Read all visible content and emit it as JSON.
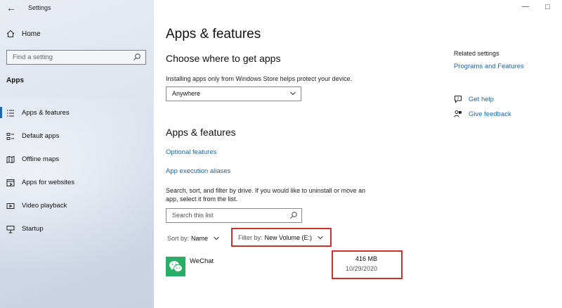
{
  "window": {
    "title": "Settings"
  },
  "sidebar": {
    "home_label": "Home",
    "search_placeholder": "Find a setting",
    "section_label": "Apps",
    "items": [
      {
        "label": "Apps & features",
        "icon": "list-icon",
        "active": true
      },
      {
        "label": "Default apps",
        "icon": "default-apps-icon",
        "active": false
      },
      {
        "label": "Offline maps",
        "icon": "map-icon",
        "active": false
      },
      {
        "label": "Apps for websites",
        "icon": "web-app-icon",
        "active": false
      },
      {
        "label": "Video playback",
        "icon": "video-icon",
        "active": false
      },
      {
        "label": "Startup",
        "icon": "startup-icon",
        "active": false
      }
    ]
  },
  "main": {
    "title": "Apps & features",
    "choose_heading": "Choose where to get apps",
    "choose_text": "Installing apps only from Windows Store helps protect your device.",
    "source_dropdown": "Anywhere",
    "apps_heading": "Apps & features",
    "optional_features_link": "Optional features",
    "aliases_link": "App execution aliases",
    "search_help_line1": "Search, sort, and filter by drive. If you would like to uninstall or move an",
    "search_help_line2": "app, select it from the list.",
    "search_placeholder": "Search this list",
    "sort_label": "Sort by:",
    "sort_value": "Name",
    "filter_label": "Filter by:",
    "filter_value": "New Volume (E:)",
    "apps": [
      {
        "name": "WeChat",
        "size": "416 MB",
        "date": "10/29/2020",
        "icon": "wechat-icon"
      }
    ]
  },
  "related": {
    "heading": "Related settings",
    "programs_link": "Programs and Features",
    "get_help": "Get help",
    "give_feedback": "Give feedback"
  },
  "colors": {
    "accent": "#1c67a9",
    "highlight_border": "#c9312b",
    "wechat_green": "#2aae67"
  }
}
